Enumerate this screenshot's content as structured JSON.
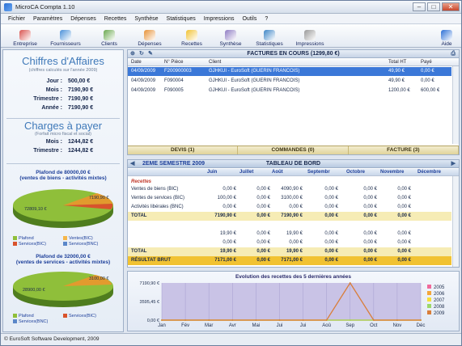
{
  "window": {
    "title": "MicroCA Compta 1.10"
  },
  "menu": [
    "Fichier",
    "Paramètres",
    "Dépenses",
    "Recettes",
    "Synthèse",
    "Statistiques",
    "Impressions",
    "Outils",
    "?"
  ],
  "toolbar": [
    {
      "label": "Entreprise",
      "icon": "building-icon",
      "color": "#d9534f"
    },
    {
      "label": "Fournisseurs",
      "icon": "suppliers-icon",
      "color": "#4a90d9"
    },
    {
      "label": "Clients",
      "icon": "clients-icon",
      "color": "#6aa84f"
    },
    {
      "label": "Dépenses",
      "icon": "expenses-icon",
      "color": "#e69138"
    },
    {
      "label": "Recettes",
      "icon": "income-icon",
      "color": "#f1c232"
    },
    {
      "label": "Synthèse",
      "icon": "summary-icon",
      "color": "#8e7cc3"
    },
    {
      "label": "Statistiques",
      "icon": "stats-icon",
      "color": "#3d85c6"
    },
    {
      "label": "Impressions",
      "icon": "print-icon",
      "color": "#999999"
    },
    {
      "label": "Aide",
      "icon": "help-icon",
      "color": "#2b6fd6"
    }
  ],
  "left": {
    "ca_title": "Chiffres d'Affaires",
    "ca_note": "(chiffres calculés sur l'année 2009)",
    "ca": [
      {
        "k": "Jour :",
        "v": "500,00 €"
      },
      {
        "k": "Mois :",
        "v": "7190,90 €"
      },
      {
        "k": "Trimestre :",
        "v": "7190,90 €"
      },
      {
        "k": "Année :",
        "v": "7190,90 €"
      }
    ],
    "ch_title": "Charges à payer",
    "ch_note": "(Forfait micro fiscal et social)",
    "ch": [
      {
        "k": "Mois :",
        "v": "1244,82 €"
      },
      {
        "k": "Trimestre :",
        "v": "1244,82 €"
      }
    ],
    "pie1": {
      "title1": "Plafond de 80000,00 €",
      "title2": "(ventes de biens - activités mixtes)",
      "big_label": "72809,10 €",
      "small_label": "7190,90 €",
      "legend": [
        "Plafond",
        "Ventes(BIC)",
        "Services(BIC)",
        "Services(BNC)"
      ]
    },
    "pie2": {
      "title1": "Plafond de 32000,00 €",
      "title2": "(ventes de services - activités mixtes)",
      "big_label": "28900,00 €",
      "small_label": "3100,00 €",
      "legend": [
        "Plafond",
        "Services(BIC)",
        "Services(BNC)"
      ]
    },
    "legend_colors": [
      "#8fbf3a",
      "#f5b64a",
      "#d9532c",
      "#5b87c9"
    ]
  },
  "invoices": {
    "header": "FACTURES EN COURS (1299,80 €)",
    "columns": [
      "Date",
      "N° Pièce",
      "Client",
      "Total HT",
      "Payé"
    ],
    "rows": [
      {
        "date": "04/09/2009",
        "num": "F200900003",
        "client": "GJHKUI - EuroSoft (GUERIN FRANCOIS)",
        "total": "49,90 €",
        "paid": "0,00 €",
        "selected": true
      },
      {
        "date": "04/09/2009",
        "num": "F090004",
        "client": "GJHKUI - EuroSoft (GUERIN FRANCOIS)",
        "total": "49,90 €",
        "paid": "0,00 €",
        "selected": false
      },
      {
        "date": "04/09/2009",
        "num": "F090005",
        "client": "GJHKUI - EuroSoft (GUERIN FRANCOIS)",
        "total": "1200,00 €",
        "paid": "600,00 €",
        "selected": false
      }
    ],
    "tabs": [
      "DEVIS (1)",
      "COMMANDES (0)",
      "FACTURE (3)"
    ]
  },
  "dashboard": {
    "semester": "2EME SEMESTRE 2009",
    "header": "TABLEAU DE BORD",
    "months": [
      "Juin",
      "Juillet",
      "Août",
      "Septembr",
      "Octobre",
      "Novembre",
      "Décembre"
    ],
    "section_recettes": "Recettes",
    "rows": [
      {
        "label": "Ventes de biens (BIC)",
        "vals": [
          "0,00 €",
          "0,00 €",
          "4090,90 €",
          "0,00 €",
          "0,00 €",
          "0,00 €"
        ],
        "style": "normal"
      },
      {
        "label": "Ventes de services (BIC)",
        "vals": [
          "100,00 €",
          "0,00 €",
          "3100,00 €",
          "0,00 €",
          "0,00 €",
          "0,00 €"
        ],
        "style": "normal"
      },
      {
        "label": "Activités libérales (BNC)",
        "vals": [
          "0,00 €",
          "0,00 €",
          "0,00 €",
          "0,00 €",
          "0,00 €",
          "0,00 €"
        ],
        "style": "normal"
      },
      {
        "label": "TOTAL",
        "vals": [
          "7190,90 €",
          "0,00 €",
          "7190,90 €",
          "0,00 €",
          "0,00 €",
          "0,00 €"
        ],
        "style": "total"
      },
      {
        "label": "",
        "vals": [
          "",
          "",
          "",
          "",
          "",
          ""
        ],
        "style": "blank"
      },
      {
        "label": "",
        "vals": [
          "19,90 €",
          "0,00 €",
          "19,90 €",
          "0,00 €",
          "0,00 €",
          "0,00 €"
        ],
        "style": "normal"
      },
      {
        "label": "",
        "vals": [
          "0,00 €",
          "0,00 €",
          "0,00 €",
          "0,00 €",
          "0,00 €",
          "0,00 €"
        ],
        "style": "normal"
      },
      {
        "label": "TOTAL",
        "vals": [
          "19,90 €",
          "0,00 €",
          "19,90 €",
          "0,00 €",
          "0,00 €",
          "0,00 €"
        ],
        "style": "total"
      },
      {
        "label": "RÉSULTAT BRUT",
        "vals": [
          "7171,00 €",
          "0,00 €",
          "7171,00 €",
          "0,00 €",
          "0,00 €",
          "0,00 €"
        ],
        "style": "result"
      }
    ]
  },
  "chart_data": {
    "type": "line",
    "title": "Evolution des recettes des 5 dernières années",
    "categories": [
      "Jan",
      "Fév",
      "Mar",
      "Avr",
      "Mai",
      "Jui",
      "Jui",
      "Aoû",
      "Sep",
      "Oct",
      "Nov",
      "Déc"
    ],
    "ylim": [
      0,
      7190.9
    ],
    "yticks": [
      "7190,90 €",
      "3595,45 €",
      "0,00 €"
    ],
    "series": [
      {
        "name": "2005",
        "color": "#f06a9b",
        "values": [
          0,
          0,
          0,
          0,
          0,
          0,
          0,
          0,
          0,
          0,
          0,
          0
        ]
      },
      {
        "name": "2006",
        "color": "#f4a63b",
        "values": [
          0,
          0,
          0,
          0,
          0,
          0,
          0,
          0,
          0,
          0,
          0,
          0
        ]
      },
      {
        "name": "2007",
        "color": "#f7df3a",
        "values": [
          0,
          0,
          0,
          0,
          0,
          0,
          0,
          0,
          0,
          0,
          0,
          0
        ]
      },
      {
        "name": "2008",
        "color": "#9cd86a",
        "values": [
          0,
          0,
          0,
          0,
          0,
          0,
          0,
          0,
          0,
          0,
          0,
          0
        ]
      },
      {
        "name": "2009",
        "color": "#d97e3a",
        "values": [
          0,
          0,
          0,
          0,
          0,
          0,
          0,
          0,
          7190.9,
          0,
          0,
          0
        ]
      }
    ],
    "legend": "right"
  },
  "status": "© EuroSoft Software Development, 2009"
}
